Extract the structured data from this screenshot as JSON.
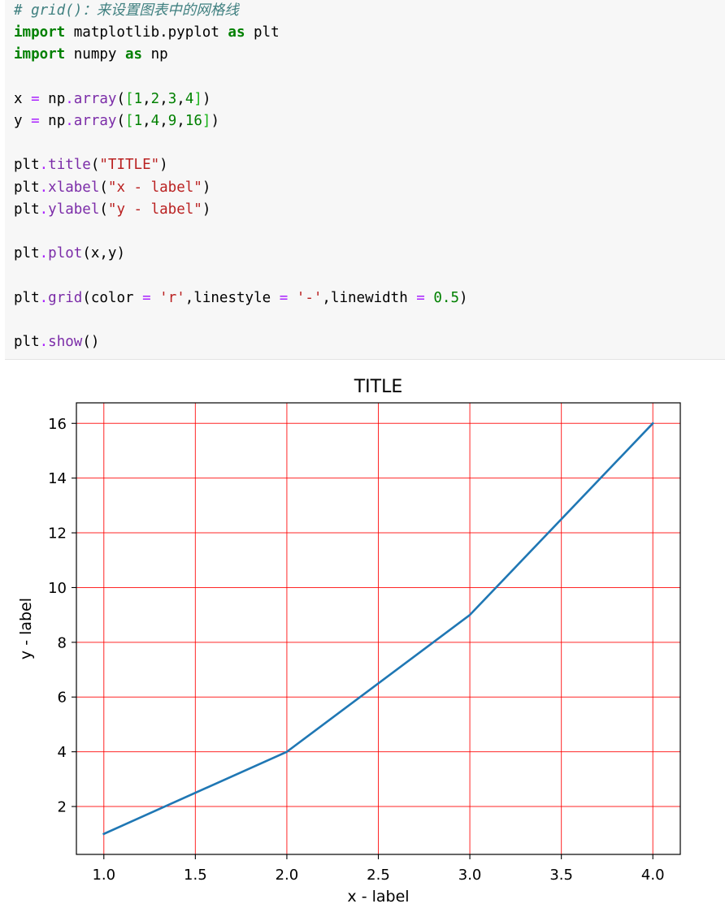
{
  "code_cell": {
    "lines": [
      [
        {
          "t": "# grid()：来设置图表中的网格线",
          "c": "comment"
        }
      ],
      [
        {
          "t": "import",
          "c": "keyword"
        },
        {
          "t": " matplotlib.pyplot ",
          "c": "plain"
        },
        {
          "t": "as",
          "c": "keyword"
        },
        {
          "t": " plt",
          "c": "plain"
        }
      ],
      [
        {
          "t": "import",
          "c": "keyword"
        },
        {
          "t": " numpy ",
          "c": "plain"
        },
        {
          "t": "as",
          "c": "keyword"
        },
        {
          "t": " np",
          "c": "plain"
        }
      ],
      [],
      [
        {
          "t": "x ",
          "c": "plain"
        },
        {
          "t": "=",
          "c": "operator"
        },
        {
          "t": " np",
          "c": "plain"
        },
        {
          "t": ".",
          "c": "operator"
        },
        {
          "t": "array",
          "c": "func"
        },
        {
          "t": "(",
          "c": "plain"
        },
        {
          "t": "[",
          "c": "bracket"
        },
        {
          "t": "1",
          "c": "number"
        },
        {
          "t": ",",
          "c": "plain"
        },
        {
          "t": "2",
          "c": "number"
        },
        {
          "t": ",",
          "c": "plain"
        },
        {
          "t": "3",
          "c": "number"
        },
        {
          "t": ",",
          "c": "plain"
        },
        {
          "t": "4",
          "c": "number"
        },
        {
          "t": "]",
          "c": "bracket"
        },
        {
          "t": ")",
          "c": "plain"
        }
      ],
      [
        {
          "t": "y ",
          "c": "plain"
        },
        {
          "t": "=",
          "c": "operator"
        },
        {
          "t": " np",
          "c": "plain"
        },
        {
          "t": ".",
          "c": "operator"
        },
        {
          "t": "array",
          "c": "func"
        },
        {
          "t": "(",
          "c": "plain"
        },
        {
          "t": "[",
          "c": "bracket"
        },
        {
          "t": "1",
          "c": "number"
        },
        {
          "t": ",",
          "c": "plain"
        },
        {
          "t": "4",
          "c": "number"
        },
        {
          "t": ",",
          "c": "plain"
        },
        {
          "t": "9",
          "c": "number"
        },
        {
          "t": ",",
          "c": "plain"
        },
        {
          "t": "16",
          "c": "number"
        },
        {
          "t": "]",
          "c": "bracket"
        },
        {
          "t": ")",
          "c": "plain"
        }
      ],
      [],
      [
        {
          "t": "plt",
          "c": "plain"
        },
        {
          "t": ".",
          "c": "operator"
        },
        {
          "t": "title",
          "c": "func"
        },
        {
          "t": "(",
          "c": "plain"
        },
        {
          "t": "\"TITLE\"",
          "c": "string"
        },
        {
          "t": ")",
          "c": "plain"
        }
      ],
      [
        {
          "t": "plt",
          "c": "plain"
        },
        {
          "t": ".",
          "c": "operator"
        },
        {
          "t": "xlabel",
          "c": "func"
        },
        {
          "t": "(",
          "c": "plain"
        },
        {
          "t": "\"x - label\"",
          "c": "string"
        },
        {
          "t": ")",
          "c": "plain"
        }
      ],
      [
        {
          "t": "plt",
          "c": "plain"
        },
        {
          "t": ".",
          "c": "operator"
        },
        {
          "t": "ylabel",
          "c": "func"
        },
        {
          "t": "(",
          "c": "plain"
        },
        {
          "t": "\"y - label\"",
          "c": "string"
        },
        {
          "t": ")",
          "c": "plain"
        }
      ],
      [],
      [
        {
          "t": "plt",
          "c": "plain"
        },
        {
          "t": ".",
          "c": "operator"
        },
        {
          "t": "plot",
          "c": "func"
        },
        {
          "t": "(x,y)",
          "c": "plain"
        }
      ],
      [],
      [
        {
          "t": "plt",
          "c": "plain"
        },
        {
          "t": ".",
          "c": "operator"
        },
        {
          "t": "grid",
          "c": "func"
        },
        {
          "t": "(color ",
          "c": "plain"
        },
        {
          "t": "=",
          "c": "operator"
        },
        {
          "t": " ",
          "c": "plain"
        },
        {
          "t": "'r'",
          "c": "string"
        },
        {
          "t": ",linestyle ",
          "c": "plain"
        },
        {
          "t": "=",
          "c": "operator"
        },
        {
          "t": " ",
          "c": "plain"
        },
        {
          "t": "'-'",
          "c": "string"
        },
        {
          "t": ",linewidth ",
          "c": "plain"
        },
        {
          "t": "=",
          "c": "operator"
        },
        {
          "t": " ",
          "c": "plain"
        },
        {
          "t": "0.5",
          "c": "number"
        },
        {
          "t": ")",
          "c": "plain"
        }
      ],
      [],
      [
        {
          "t": "plt",
          "c": "plain"
        },
        {
          "t": ".",
          "c": "operator"
        },
        {
          "t": "show",
          "c": "func"
        },
        {
          "t": "()",
          "c": "plain"
        }
      ]
    ]
  },
  "syntax_colors": {
    "comment": "#408080",
    "keyword": "#008000",
    "plain": "#000000",
    "operator": "#aa22ff",
    "func": "#7b2ca8",
    "number": "#008000",
    "string": "#ba2121",
    "bracket": "#19b319"
  },
  "chart_data": {
    "type": "line",
    "title": "TITLE",
    "xlabel": "x - label",
    "ylabel": "y - label",
    "x": [
      1,
      2,
      3,
      4
    ],
    "series": [
      {
        "values": [
          1,
          4,
          9,
          16
        ],
        "color": "#1f77b4"
      }
    ],
    "xlim": [
      0.85,
      4.15
    ],
    "ylim": [
      0.25,
      16.75
    ],
    "xticks": [
      1.0,
      1.5,
      2.0,
      2.5,
      3.0,
      3.5,
      4.0
    ],
    "xtick_labels": [
      "1.0",
      "1.5",
      "2.0",
      "2.5",
      "3.0",
      "3.5",
      "4.0"
    ],
    "yticks": [
      2,
      4,
      6,
      8,
      10,
      12,
      14,
      16
    ],
    "ytick_labels": [
      "2",
      "4",
      "6",
      "8",
      "10",
      "12",
      "14",
      "16"
    ],
    "grid": true,
    "grid_color": "#ff0000",
    "grid_linestyle": "-",
    "grid_linewidth": 0.5
  }
}
